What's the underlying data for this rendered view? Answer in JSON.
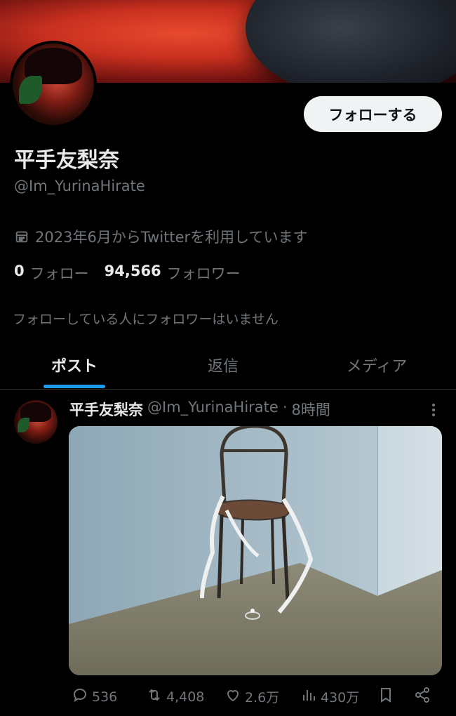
{
  "profile": {
    "follow_button": "フォローする",
    "display_name": "平手友梨奈",
    "handle": "@Im_YurinaHirate",
    "joined": "2023年6月からTwitterを利用しています",
    "following_count": "0",
    "following_label": "フォロー",
    "followers_count": "94,566",
    "followers_label": "フォロワー",
    "mutual_note": "フォローしている人にフォロワーはいません"
  },
  "tabs": [
    {
      "label": "ポスト",
      "active": true
    },
    {
      "label": "返信",
      "active": false
    },
    {
      "label": "メディア",
      "active": false
    }
  ],
  "post": {
    "author_name": "平手友梨奈",
    "author_handle": "@Im_YurinaHirate",
    "separator": "·",
    "time": "8時間",
    "replies": "536",
    "reposts": "4,408",
    "likes": "2.6万",
    "views": "430万"
  },
  "colors": {
    "accent": "#1d9bf0",
    "background": "#000000",
    "muted_text": "#71767b"
  },
  "icons": [
    "calendar-icon",
    "more-icon",
    "reply-icon",
    "repost-icon",
    "like-icon",
    "views-icon",
    "bookmark-icon",
    "share-icon"
  ]
}
